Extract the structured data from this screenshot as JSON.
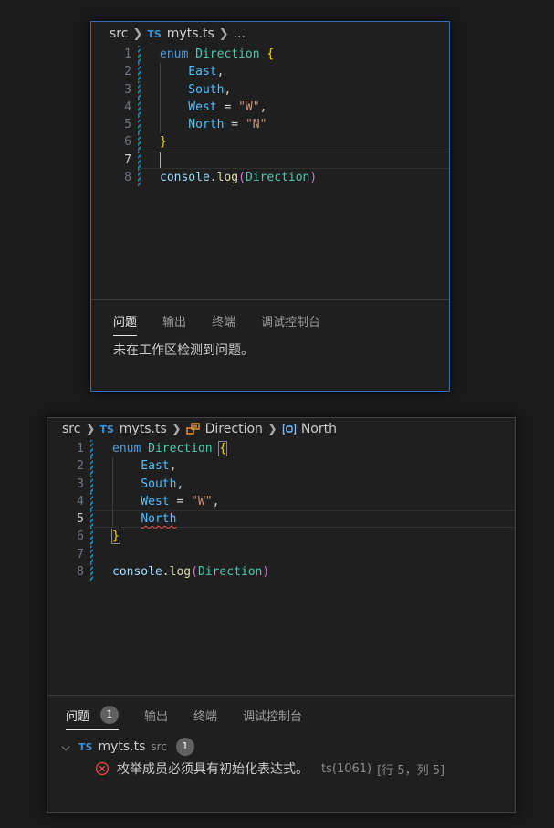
{
  "window1": {
    "breadcrumb": {
      "folder": "src",
      "file_badge": "TS",
      "file": "myts.ts",
      "more": "..."
    },
    "lines": [
      {
        "n": "1",
        "tokens": [
          {
            "t": "enum",
            "c": "kw"
          },
          {
            "t": " ",
            "c": "op"
          },
          {
            "t": "Direction",
            "c": "ty"
          },
          {
            "t": " ",
            "c": "op"
          },
          {
            "t": "{",
            "c": "br"
          }
        ]
      },
      {
        "n": "2",
        "tokens": [
          {
            "t": "    East",
            "c": "mem"
          },
          {
            "t": ",",
            "c": "op"
          }
        ]
      },
      {
        "n": "3",
        "tokens": [
          {
            "t": "    South",
            "c": "mem"
          },
          {
            "t": ",",
            "c": "op"
          }
        ]
      },
      {
        "n": "4",
        "tokens": [
          {
            "t": "    West",
            "c": "mem"
          },
          {
            "t": " = ",
            "c": "op"
          },
          {
            "t": "\"W\"",
            "c": "str"
          },
          {
            "t": ",",
            "c": "op"
          }
        ]
      },
      {
        "n": "5",
        "tokens": [
          {
            "t": "    North",
            "c": "mem"
          },
          {
            "t": " = ",
            "c": "op"
          },
          {
            "t": "\"N\"",
            "c": "str"
          }
        ]
      },
      {
        "n": "6",
        "tokens": [
          {
            "t": "}",
            "c": "br"
          }
        ]
      },
      {
        "n": "7",
        "tokens": []
      },
      {
        "n": "8",
        "tokens": [
          {
            "t": "console",
            "c": "id"
          },
          {
            "t": ".",
            "c": "op"
          },
          {
            "t": "log",
            "c": "fn"
          },
          {
            "t": "(",
            "c": "pa"
          },
          {
            "t": "Direction",
            "c": "ty"
          },
          {
            "t": ")",
            "c": "pa"
          }
        ]
      }
    ],
    "active_line": 7,
    "panel": {
      "tabs": [
        {
          "label": "问题",
          "active": true
        },
        {
          "label": "输出"
        },
        {
          "label": "终端"
        },
        {
          "label": "调试控制台"
        }
      ],
      "message": "未在工作区检测到问题。"
    }
  },
  "window2": {
    "breadcrumb": {
      "folder": "src",
      "file_badge": "TS",
      "file": "myts.ts",
      "symbol1": "Direction",
      "symbol2": "North"
    },
    "lines": [
      {
        "n": "1",
        "tokens": [
          {
            "t": "enum",
            "c": "kw"
          },
          {
            "t": " ",
            "c": "op"
          },
          {
            "t": "Direction",
            "c": "ty"
          },
          {
            "t": " ",
            "c": "op"
          },
          {
            "t": "{",
            "c": "br br-hl"
          }
        ]
      },
      {
        "n": "2",
        "tokens": [
          {
            "t": "    East",
            "c": "mem"
          },
          {
            "t": ",",
            "c": "op"
          }
        ]
      },
      {
        "n": "3",
        "tokens": [
          {
            "t": "    South",
            "c": "mem"
          },
          {
            "t": ",",
            "c": "op"
          }
        ]
      },
      {
        "n": "4",
        "tokens": [
          {
            "t": "    West",
            "c": "mem"
          },
          {
            "t": " = ",
            "c": "op"
          },
          {
            "t": "\"W\"",
            "c": "str"
          },
          {
            "t": ",",
            "c": "op"
          }
        ]
      },
      {
        "n": "5",
        "tokens": [
          {
            "t": "    ",
            "c": "op"
          },
          {
            "t": "North",
            "c": "mem squig"
          }
        ]
      },
      {
        "n": "6",
        "tokens": [
          {
            "t": "}",
            "c": "br br-hl"
          }
        ]
      },
      {
        "n": "7",
        "tokens": []
      },
      {
        "n": "8",
        "tokens": [
          {
            "t": "console",
            "c": "id"
          },
          {
            "t": ".",
            "c": "op"
          },
          {
            "t": "log",
            "c": "fn"
          },
          {
            "t": "(",
            "c": "pa"
          },
          {
            "t": "Direction",
            "c": "ty"
          },
          {
            "t": ")",
            "c": "pa"
          }
        ]
      }
    ],
    "active_line": 5,
    "panel": {
      "tabs": [
        {
          "label": "问题",
          "active": true,
          "count": "1"
        },
        {
          "label": "输出"
        },
        {
          "label": "终端"
        },
        {
          "label": "调试控制台"
        }
      ],
      "file_row": {
        "badge": "TS",
        "file": "myts.ts",
        "folder": "src",
        "count": "1"
      },
      "error": {
        "message": "枚举成员必须具有初始化表达式。",
        "source": "ts(1061)",
        "position": "[行 5，列 5]"
      }
    }
  },
  "colors": {
    "accent_border": "#2f6fb0",
    "error": "#f14c4c",
    "ts_badge": "#3d8fd6",
    "enum_icon": "#ee9d28",
    "member_icon": "#75beff"
  }
}
